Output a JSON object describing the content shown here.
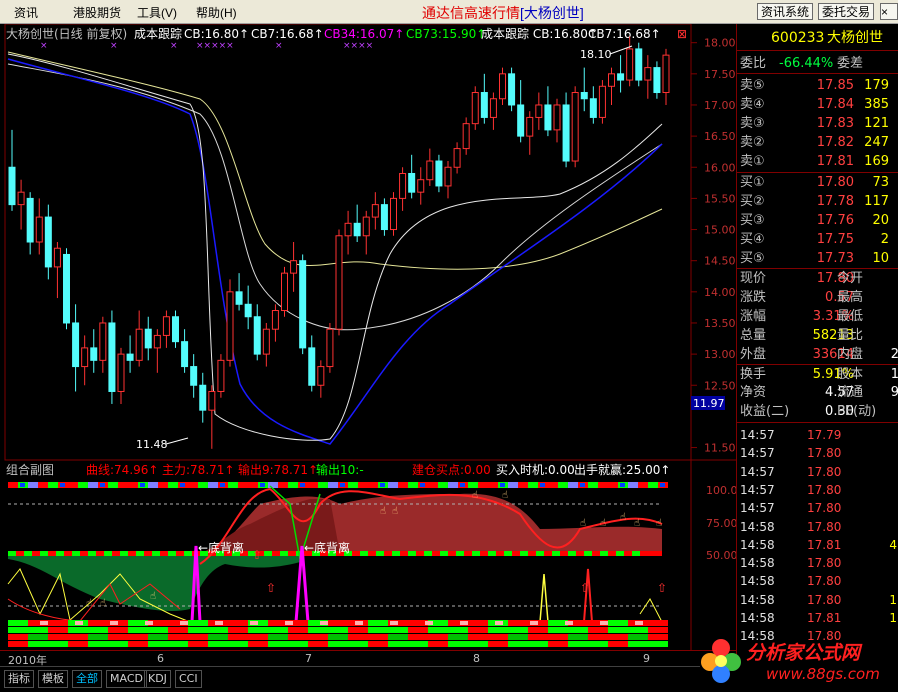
{
  "menu": {
    "items": [
      "资讯",
      "港股期货",
      "工具(V)",
      "帮助(H)"
    ],
    "title": "通达信高速行情",
    "title_tag": "[大杨创世]",
    "buttons": [
      "资讯系统",
      "委托交易"
    ]
  },
  "chart_header": {
    "stock": "大杨创世(日线 前复权)",
    "items": [
      {
        "text": "成本跟踪",
        "color": "#ffffff"
      },
      {
        "text": "CB:16.80↑",
        "color": "#ffffff"
      },
      {
        "text": "CB7:16.68↑",
        "color": "#ffffff"
      },
      {
        "text": "CB34:16.07↑",
        "color": "#ff00ff"
      },
      {
        "text": "CB73:15.90↑",
        "color": "#00ff00"
      },
      {
        "text": "成本跟踪 CB:16.80↑",
        "color": "#ffffff"
      },
      {
        "text": "CB7:16.68↑",
        "color": "#ffffff"
      }
    ],
    "close_glyph": "⊠"
  },
  "price_axis": {
    "ticks": [
      "18.00",
      "17.50",
      "17.00",
      "16.50",
      "16.00",
      "15.50",
      "15.00",
      "14.50",
      "14.00",
      "13.50",
      "13.00",
      "12.50",
      "11.97",
      "11.50"
    ],
    "current_label": "11.97"
  },
  "annotations": {
    "high": "18.10",
    "low": "11.48"
  },
  "sub_header": {
    "title": "组合副图",
    "items": [
      {
        "text": "曲线:74.96↑",
        "color": "#ff0000"
      },
      {
        "text": "主力:78.71↑",
        "color": "#ff0000"
      },
      {
        "text": "输出9:78.71↑",
        "color": "#ff0000"
      },
      {
        "text": "输出10:-",
        "color": "#00ff00"
      },
      {
        "text": "建仓买点:0.00",
        "color": "#ff0000"
      },
      {
        "text": "买入时机:0.00",
        "color": "#ffffff"
      },
      {
        "text": "出手就赢:25.00↑",
        "color": "#ffffff"
      }
    ],
    "ticks": [
      "100.0",
      "75.00",
      "50.00"
    ],
    "divergence": [
      "←底背离",
      "←底背离"
    ]
  },
  "date_axis": {
    "labels": [
      "2010年",
      "6",
      "7",
      "8",
      "9"
    ]
  },
  "tabs": [
    "指标",
    "模板",
    "全部",
    "MACD",
    "KDJ",
    "CCI"
  ],
  "quote": {
    "code": "600233",
    "name": "大杨创世",
    "weibi_label": "委比",
    "weibi_value": "-66.44%",
    "weicha_label": "委差",
    "sells": [
      {
        "label": "卖⑤",
        "price": "17.85",
        "vol": "179"
      },
      {
        "label": "卖④",
        "price": "17.84",
        "vol": "385"
      },
      {
        "label": "卖③",
        "price": "17.83",
        "vol": "121"
      },
      {
        "label": "卖②",
        "price": "17.82",
        "vol": "247"
      },
      {
        "label": "卖①",
        "price": "17.81",
        "vol": "169"
      }
    ],
    "buys": [
      {
        "label": "买①",
        "price": "17.80",
        "vol": "73"
      },
      {
        "label": "买②",
        "price": "17.78",
        "vol": "117"
      },
      {
        "label": "买③",
        "price": "17.76",
        "vol": "20"
      },
      {
        "label": "买④",
        "price": "17.75",
        "vol": "2"
      },
      {
        "label": "买⑤",
        "price": "17.73",
        "vol": "10"
      }
    ],
    "stats": [
      {
        "label": "现价",
        "value": "17.80",
        "color": "#ff4040",
        "label2": "今开"
      },
      {
        "label": "涨跌",
        "value": "0.57",
        "color": "#ff4040",
        "label2": "最高"
      },
      {
        "label": "涨幅",
        "value": "3.31%",
        "color": "#ff4040",
        "label2": "最低"
      },
      {
        "label": "总量",
        "value": "58213",
        "color": "#ffff00",
        "label2": "量比"
      },
      {
        "label": "外盘",
        "value": "33614",
        "color": "#ff4040",
        "label2": "内盘",
        "tail": "2"
      },
      {
        "label": "换手",
        "value": "5.91%",
        "color": "#ffff00",
        "label2": "股本",
        "tail": "1"
      },
      {
        "label": "净资",
        "value": "4.57",
        "color": "#ffffff",
        "label2": "流通",
        "tail": "9"
      },
      {
        "label": "收益(二)",
        "value": "0.30",
        "color": "#ffffff",
        "label2": "PE(动)"
      }
    ],
    "ticks": [
      {
        "time": "14:57",
        "price": "17.79",
        "color": "#ff4040",
        "vol": ""
      },
      {
        "time": "14:57",
        "price": "17.80",
        "color": "#ff4040",
        "vol": ""
      },
      {
        "time": "14:57",
        "price": "17.80",
        "color": "#ff4040",
        "vol": ""
      },
      {
        "time": "14:57",
        "price": "17.80",
        "color": "#ff4040",
        "vol": ""
      },
      {
        "time": "14:57",
        "price": "17.80",
        "color": "#ff4040",
        "vol": ""
      },
      {
        "time": "14:58",
        "price": "17.80",
        "color": "#ff4040",
        "vol": ""
      },
      {
        "time": "14:58",
        "price": "17.81",
        "color": "#ff4040",
        "vol": "4"
      },
      {
        "time": "14:58",
        "price": "17.80",
        "color": "#ff4040",
        "vol": ""
      },
      {
        "time": "14:58",
        "price": "17.80",
        "color": "#ff4040",
        "vol": ""
      },
      {
        "time": "14:58",
        "price": "17.80",
        "color": "#ff4040",
        "vol": "1"
      },
      {
        "time": "14:58",
        "price": "17.81",
        "color": "#ff4040",
        "vol": "1"
      },
      {
        "time": "14:58",
        "price": "17.80",
        "color": "#ff4040",
        "vol": ""
      }
    ]
  },
  "watermark": {
    "text": "分析家公式网",
    "url": "www.88gs.com"
  },
  "chart_data": {
    "type": "candlestick",
    "ylim": [
      11.3,
      18.3
    ],
    "candles": [
      [
        16.0,
        16.6,
        15.3,
        15.4
      ],
      [
        15.4,
        15.8,
        15.0,
        15.6
      ],
      [
        15.5,
        15.6,
        14.6,
        14.8
      ],
      [
        14.8,
        15.5,
        14.6,
        15.2
      ],
      [
        15.2,
        15.4,
        14.2,
        14.4
      ],
      [
        14.4,
        14.8,
        13.9,
        14.7
      ],
      [
        14.6,
        14.7,
        13.4,
        13.5
      ],
      [
        13.5,
        13.8,
        12.4,
        12.8
      ],
      [
        12.8,
        13.3,
        12.5,
        13.1
      ],
      [
        13.1,
        13.4,
        12.7,
        12.9
      ],
      [
        12.9,
        13.6,
        12.7,
        13.5
      ],
      [
        13.5,
        13.7,
        12.2,
        12.4
      ],
      [
        12.4,
        13.1,
        12.2,
        13.0
      ],
      [
        13.0,
        13.3,
        12.7,
        12.9
      ],
      [
        12.9,
        13.7,
        12.8,
        13.4
      ],
      [
        13.4,
        13.6,
        12.9,
        13.1
      ],
      [
        13.1,
        13.4,
        12.7,
        13.3
      ],
      [
        13.3,
        13.7,
        13.1,
        13.6
      ],
      [
        13.6,
        13.7,
        13.1,
        13.2
      ],
      [
        13.2,
        13.4,
        12.7,
        12.8
      ],
      [
        12.8,
        13.0,
        12.3,
        12.5
      ],
      [
        12.5,
        12.7,
        11.9,
        12.1
      ],
      [
        12.1,
        12.5,
        11.48,
        12.4
      ],
      [
        12.4,
        13.0,
        12.3,
        12.9
      ],
      [
        12.9,
        14.2,
        12.8,
        14.0
      ],
      [
        14.0,
        14.3,
        13.7,
        13.8
      ],
      [
        13.8,
        14.1,
        13.4,
        13.6
      ],
      [
        13.6,
        13.8,
        12.9,
        13.0
      ],
      [
        13.0,
        13.5,
        12.8,
        13.4
      ],
      [
        13.4,
        13.8,
        13.2,
        13.7
      ],
      [
        13.7,
        14.4,
        13.6,
        14.3
      ],
      [
        14.3,
        14.8,
        14.0,
        14.5
      ],
      [
        14.5,
        14.6,
        13.0,
        13.1
      ],
      [
        13.1,
        13.3,
        12.4,
        12.5
      ],
      [
        12.5,
        12.9,
        12.3,
        12.8
      ],
      [
        12.8,
        13.5,
        12.7,
        13.4
      ],
      [
        13.4,
        15.0,
        13.3,
        14.9
      ],
      [
        14.9,
        15.3,
        14.6,
        15.1
      ],
      [
        15.1,
        15.4,
        14.8,
        14.9
      ],
      [
        14.9,
        15.3,
        14.6,
        15.2
      ],
      [
        15.2,
        15.6,
        15.0,
        15.4
      ],
      [
        15.4,
        15.5,
        14.9,
        15.0
      ],
      [
        15.0,
        15.6,
        14.9,
        15.5
      ],
      [
        15.5,
        16.0,
        15.3,
        15.9
      ],
      [
        15.9,
        16.2,
        15.5,
        15.6
      ],
      [
        15.6,
        16.0,
        15.4,
        15.8
      ],
      [
        15.8,
        16.3,
        15.7,
        16.1
      ],
      [
        16.1,
        16.2,
        15.6,
        15.7
      ],
      [
        15.7,
        16.1,
        15.5,
        16.0
      ],
      [
        16.0,
        16.4,
        15.9,
        16.3
      ],
      [
        16.3,
        16.8,
        16.2,
        16.7
      ],
      [
        16.7,
        17.3,
        16.6,
        17.2
      ],
      [
        17.2,
        17.5,
        16.7,
        16.8
      ],
      [
        16.8,
        17.2,
        16.6,
        17.1
      ],
      [
        17.1,
        17.6,
        17.0,
        17.5
      ],
      [
        17.5,
        17.6,
        16.9,
        17.0
      ],
      [
        17.0,
        17.4,
        16.4,
        16.5
      ],
      [
        16.5,
        16.9,
        16.2,
        16.8
      ],
      [
        16.8,
        17.2,
        16.6,
        17.0
      ],
      [
        17.0,
        17.3,
        16.5,
        16.6
      ],
      [
        16.6,
        17.1,
        16.4,
        17.0
      ],
      [
        17.0,
        17.2,
        16.0,
        16.1
      ],
      [
        16.1,
        17.3,
        16.0,
        17.2
      ],
      [
        17.2,
        17.6,
        16.9,
        17.1
      ],
      [
        17.1,
        17.3,
        16.7,
        16.8
      ],
      [
        16.8,
        17.4,
        16.7,
        17.3
      ],
      [
        17.3,
        17.6,
        17.0,
        17.5
      ],
      [
        17.5,
        17.8,
        17.2,
        17.4
      ],
      [
        17.4,
        18.1,
        17.3,
        17.9
      ],
      [
        17.9,
        18.0,
        17.3,
        17.4
      ],
      [
        17.4,
        17.8,
        17.1,
        17.6
      ],
      [
        17.6,
        17.7,
        17.1,
        17.2
      ],
      [
        17.2,
        17.9,
        17.0,
        17.8
      ]
    ]
  }
}
